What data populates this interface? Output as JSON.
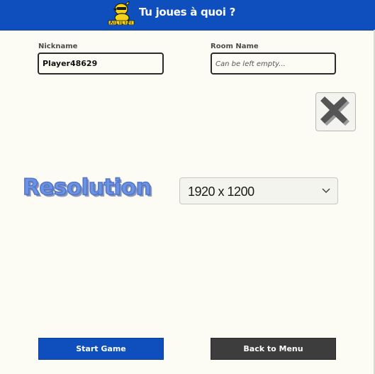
{
  "header": {
    "title": "Tu joues à quoi ?",
    "logo_icon": "duck-mascot-logo",
    "background_color": "#0e4ebd"
  },
  "form": {
    "nickname": {
      "label": "Nickname",
      "value": "Player48629"
    },
    "room_name": {
      "label": "Room Name",
      "placeholder": "Can be left empty..."
    }
  },
  "close_button": {
    "icon": "x-icon"
  },
  "resolution": {
    "label": "Resolution",
    "selected": "1920 x 1200",
    "label_color": "#6b93e3"
  },
  "actions": {
    "start_label": "Start Game",
    "back_label": "Back to Menu",
    "start_color": "#0e4ebd",
    "back_color": "#3d3d3d"
  }
}
